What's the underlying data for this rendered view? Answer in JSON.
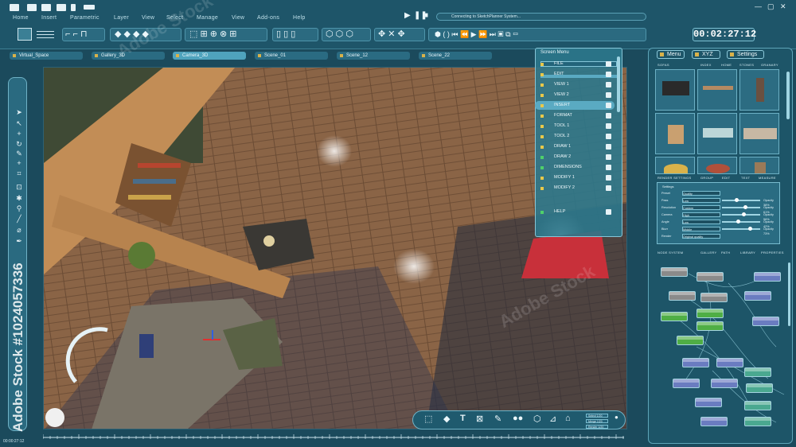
{
  "app": {
    "menu": [
      "Home",
      "Insert",
      "Parametric",
      "Layer",
      "View",
      "Select",
      "Manage",
      "View",
      "Add-ons",
      "Help"
    ],
    "status_text": "Connecting to SketchPlanner System...",
    "timer": "00:02:27:12",
    "colors": {
      "background": "#1b4a5c",
      "panel": "#1d5568",
      "accent": "#4fa3bd",
      "highlight_tab": "#4fa3bd",
      "rug": "#c8303a",
      "floor": "#8a6446"
    }
  },
  "tabs": [
    "Virtual_Space",
    "Gallery_3D",
    "Camera_3D",
    "Scene_01",
    "Scene_12",
    "Scene_22"
  ],
  "active_tab": "Camera_3D",
  "screen_menu": {
    "title": "Screen Menu",
    "items": [
      {
        "label": "FILE",
        "color": "#e8c84a"
      },
      {
        "label": "EDIT",
        "color": "#e8c84a"
      },
      {
        "label": "VIEW 1",
        "color": "#e8c84a"
      },
      {
        "label": "VIEW 2",
        "color": "#e8c84a"
      },
      {
        "label": "INSERT",
        "color": "#e8c84a"
      },
      {
        "label": "FORMAT",
        "color": "#e8c84a"
      },
      {
        "label": "TOOL 1",
        "color": "#e8c84a"
      },
      {
        "label": "TOOL 2",
        "color": "#e8c84a"
      },
      {
        "label": "DRAW 1",
        "color": "#e8c84a"
      },
      {
        "label": "DRAW 2",
        "color": "#4fd06a"
      },
      {
        "label": "DIMENSIONS",
        "color": "#4fd06a"
      },
      {
        "label": "MODIFY 1",
        "color": "#e8c84a"
      },
      {
        "label": "MODIFY 2",
        "color": "#e8c84a"
      },
      {
        "label": "HELP",
        "color": "#4fd06a"
      }
    ],
    "selected": "INSERT"
  },
  "right_panel": {
    "buttons": [
      "Menu",
      "XYZ",
      "Settings"
    ],
    "settings_title": "Settings",
    "settings_rows": [
      {
        "label": "Preset",
        "value": "Quality"
      },
      {
        "label": "Pass",
        "value": "Low",
        "opacity": "Opacity 38%"
      },
      {
        "label": "Resolution",
        "value": "Custom",
        "opacity": "Opacity 61%"
      },
      {
        "label": "Camera",
        "value": "High",
        "opacity": "Opacity 56%"
      },
      {
        "label": "Angle",
        "value": "Low",
        "opacity": "Opacity 42%"
      },
      {
        "label": "Blurr",
        "value": "Middle",
        "opacity": "Opacity 73%"
      },
      {
        "label": "Render",
        "value": "Original quality"
      }
    ],
    "tab_rows_top": [
      "RENDER SETTINGS",
      "GROUP",
      "EDIT",
      "TEXT",
      "MEASURE"
    ],
    "tab_rows_mid": [
      "NODE SYSTEM",
      "GALLERY",
      "PATH",
      "LIBRARY",
      "PROPERTIES"
    ],
    "tab_rows_lib": [
      "SOFAS",
      "INDEX",
      "HOME",
      "STONES",
      "GRANARY"
    ]
  },
  "watermark": "Adobe Stock #1024057336",
  "bottom_time": "00:00:27:12",
  "coords": [
    "Select 1/20",
    "Merge 1/20",
    "Render 1/20"
  ]
}
